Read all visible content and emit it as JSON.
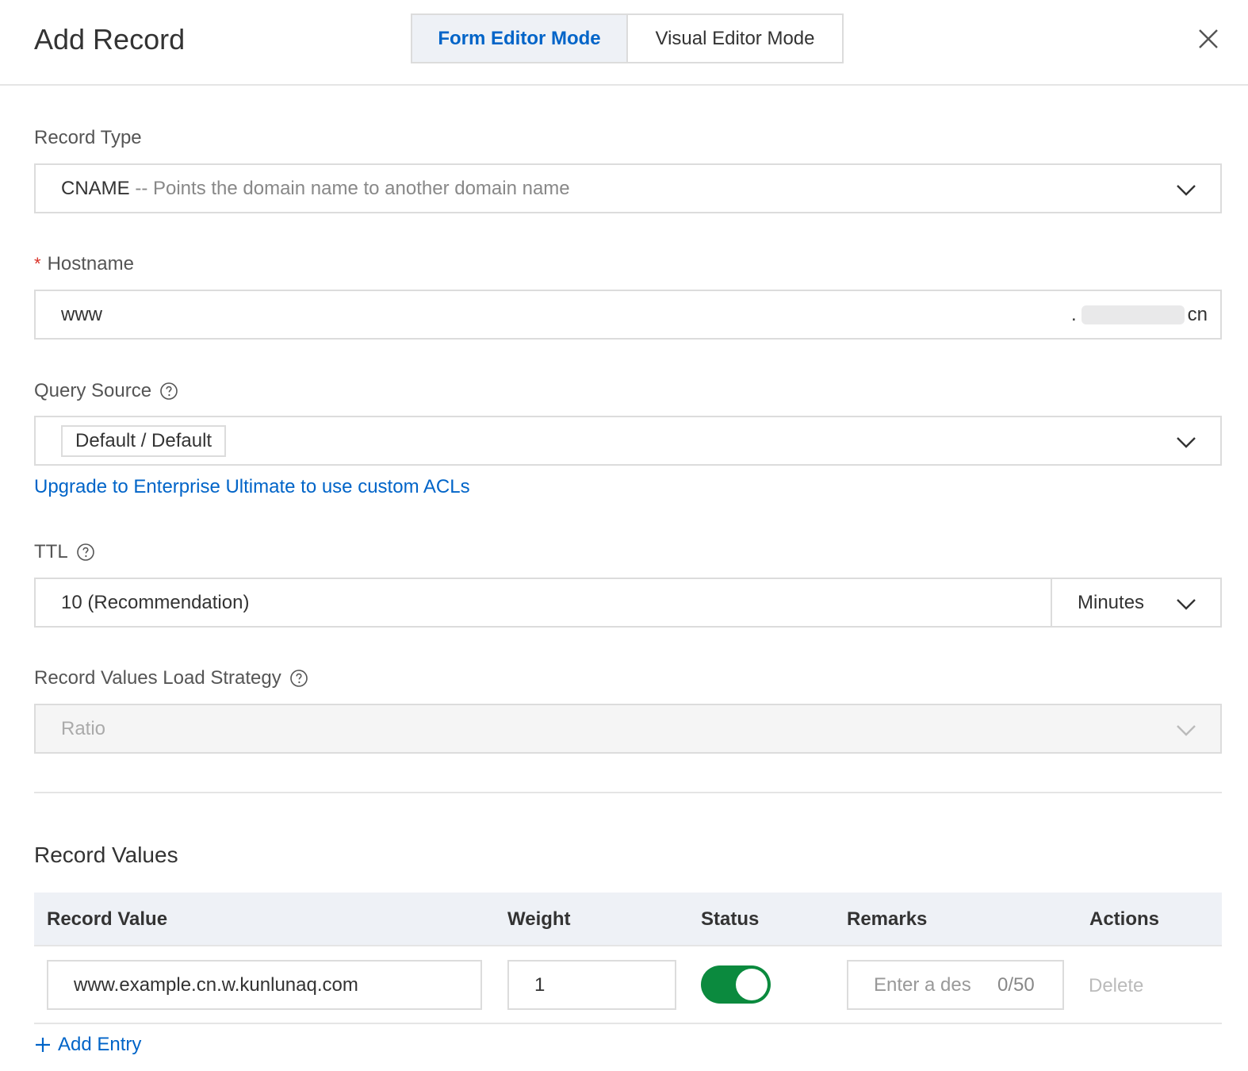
{
  "dialog": {
    "title": "Add Record",
    "modes": {
      "form": "Form Editor Mode",
      "visual": "Visual Editor Mode"
    }
  },
  "record_type": {
    "label": "Record Type",
    "value": "CNAME",
    "description": " -- Points the domain name to another domain name"
  },
  "hostname": {
    "required_mark": "*",
    "label": "Hostname",
    "value": "www",
    "suffix_dot": ".",
    "suffix_tld": "cn"
  },
  "query_source": {
    "label": "Query Source",
    "tag": "Default / Default",
    "upgrade_link": "Upgrade to Enterprise Ultimate to use custom ACLs"
  },
  "ttl": {
    "label": "TTL",
    "value": "10 (Recommendation)",
    "unit": "Minutes"
  },
  "load_strategy": {
    "label": "Record Values Load Strategy",
    "value": "Ratio"
  },
  "record_values": {
    "title": "Record Values",
    "columns": [
      "Record Value",
      "Weight",
      "Status",
      "Remarks",
      "Actions"
    ],
    "rows": [
      {
        "record_value": "www.example.cn.w.kunlunaq.com",
        "weight": "1",
        "status_enabled": true,
        "remarks_placeholder": "Enter a des",
        "remarks_count": "0/50",
        "action": "Delete"
      }
    ],
    "add_entry": "Add Entry"
  },
  "colors": {
    "accent": "#0064c8",
    "toggle_on": "#0b8a3e",
    "required": "#d93026"
  }
}
